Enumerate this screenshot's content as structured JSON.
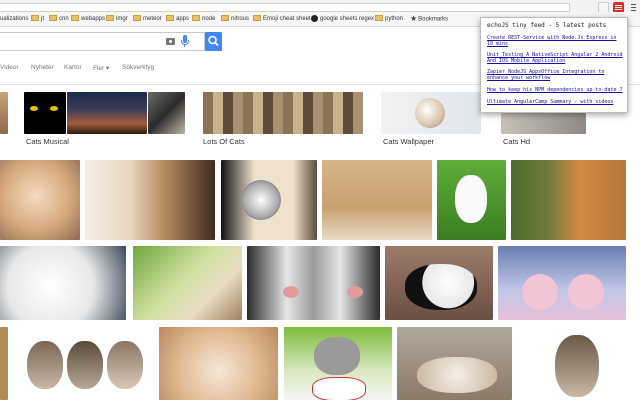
{
  "bookmarks": [
    "ualizations",
    "jt",
    "cnn",
    "webapps",
    "lmgr",
    "meteor",
    "apps",
    "node",
    "nitrous",
    "Emoji cheat sheet",
    "google sheets regex",
    "python",
    "Bookmarks"
  ],
  "tabs": [
    "Videor",
    "Nyheter",
    "Kartor",
    "Fler ▾",
    "Sökverktyg"
  ],
  "captions": [
    "Cats Musical",
    "Lots Of Cats",
    "Cats Wallpaper",
    "Cats Hd"
  ],
  "popup": {
    "title": "echoJS tiny feed - 5 latest posts",
    "links": [
      "Create REST-Service with Node.Js Express in 10 mins",
      "Unit Testing A NativeScript Angular 2 Android And IOS Mobile Application",
      "Zapier NodeJS AppsOffice Integration to enhance your workflow",
      "How to keep his NPM dependencies up-to-date ?",
      "Ultimate AngularCamp Summary - with videos"
    ]
  },
  "icons": [
    "camera-icon",
    "mic-icon",
    "search-icon",
    "extension-icon",
    "menu-icon"
  ],
  "colors": {
    "accent_blue": "#4285f4",
    "link": "#1a0dab",
    "extension_red": "#d93025"
  }
}
